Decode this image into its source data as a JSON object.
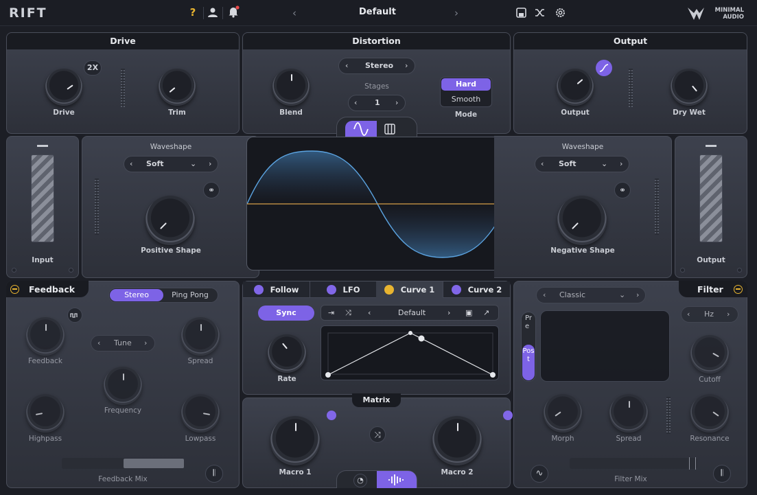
{
  "app": {
    "logo": "RIFT",
    "preset": "Default",
    "brand_line1": "MINIMAL",
    "brand_line2": "AUDIO",
    "help_icon": "?"
  },
  "drive": {
    "title": "Drive",
    "drive_label": "Drive",
    "trim_label": "Trim",
    "oversample": "2X"
  },
  "distortion": {
    "title": "Distortion",
    "channel": "Stereo",
    "stages_label": "Stages",
    "stages": "1",
    "blend_label": "Blend",
    "mode_label": "Mode",
    "modes": [
      "Hard",
      "Smooth"
    ],
    "selected_mode": "Hard"
  },
  "output_panel": {
    "title": "Output",
    "output_label": "Output",
    "drywet_label": "Dry Wet"
  },
  "input_meter": {
    "label": "Input"
  },
  "output_meter": {
    "label": "Output"
  },
  "left_shape": {
    "title": "Waveshape",
    "type": "Soft",
    "knob_label": "Positive Shape"
  },
  "right_shape": {
    "title": "Waveshape",
    "type": "Soft",
    "knob_label": "Negative Shape"
  },
  "feedback": {
    "title": "Feedback",
    "modes": [
      "Stereo",
      "Ping Pong"
    ],
    "selected_mode": "Stereo",
    "tune": "Tune",
    "feedback_label": "Feedback",
    "spread_label": "Spread",
    "frequency_label": "Frequency",
    "highpass_label": "Highpass",
    "lowpass_label": "Lowpass",
    "mix_label": "Feedback Mix"
  },
  "mod": {
    "tabs": [
      "Follow",
      "LFO",
      "Curve 1",
      "Curve 2"
    ],
    "active_tab": "Curve 1",
    "sync": "Sync",
    "preset": "Default",
    "rate_label": "Rate"
  },
  "matrix": {
    "title": "Matrix",
    "macro1": "Macro 1",
    "macro2": "Macro 2"
  },
  "filter": {
    "title": "Filter",
    "type": "Classic",
    "unit": "Hz",
    "pre": "Pre",
    "post": "Post",
    "cutoff_label": "Cutoff",
    "morph_label": "Morph",
    "spread_label": "Spread",
    "resonance_label": "Resonance",
    "mix_label": "Filter Mix"
  },
  "colors": {
    "accent": "#7d63e6",
    "highlight": "#e8b430",
    "curve": "#5ba3e0",
    "zero_line": "#d8a04a"
  }
}
